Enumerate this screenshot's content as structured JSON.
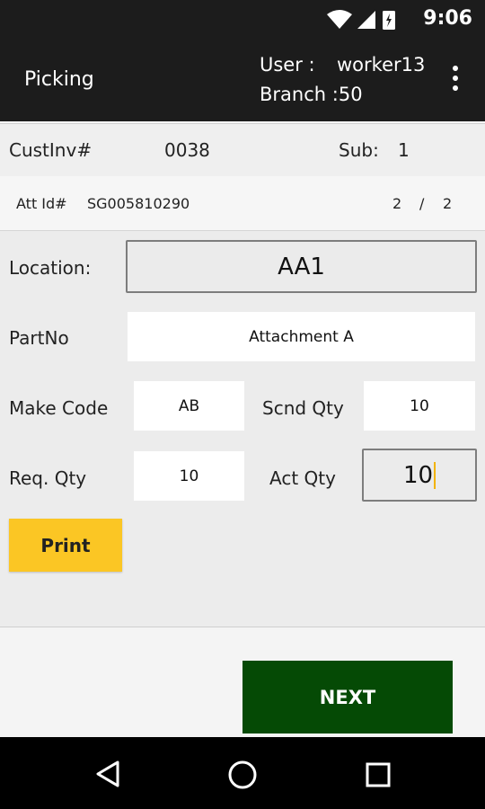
{
  "status_bar": {
    "time": "9:06",
    "icons": [
      "wifi-icon",
      "signal-icon",
      "battery-icon"
    ]
  },
  "app_bar": {
    "title": "Picking",
    "user_label": "User :",
    "user_value": "worker13",
    "branch_label": "Branch :",
    "branch_value": "50"
  },
  "header_row": {
    "custinv_label": "CustInv#",
    "custinv_value": "0038",
    "sub_label": "Sub:",
    "sub_value": "1"
  },
  "att_row": {
    "att_label": "Att Id#",
    "att_value": "SG005810290",
    "page_current": "2",
    "page_sep": "/",
    "page_total": "2"
  },
  "form": {
    "location_label": "Location:",
    "location_value": "AA1",
    "partno_label": "PartNo",
    "partno_value": "Attachment A",
    "makecode_label": "Make Code",
    "makecode_value": "AB",
    "scndqty_label": "Scnd Qty",
    "scndqty_value": "10",
    "reqqty_label": "Req. Qty",
    "reqqty_value": "10",
    "actqty_label": "Act Qty",
    "actqty_value": "10",
    "print_label": "Print"
  },
  "actions": {
    "next_label": "NEXT"
  },
  "nav_bar": {
    "icons": [
      "back-icon",
      "home-icon",
      "recents-icon"
    ]
  },
  "colors": {
    "bar": "#1c1c1c",
    "print": "#fbc624",
    "next": "#054a05",
    "caret": "#f2b300"
  }
}
